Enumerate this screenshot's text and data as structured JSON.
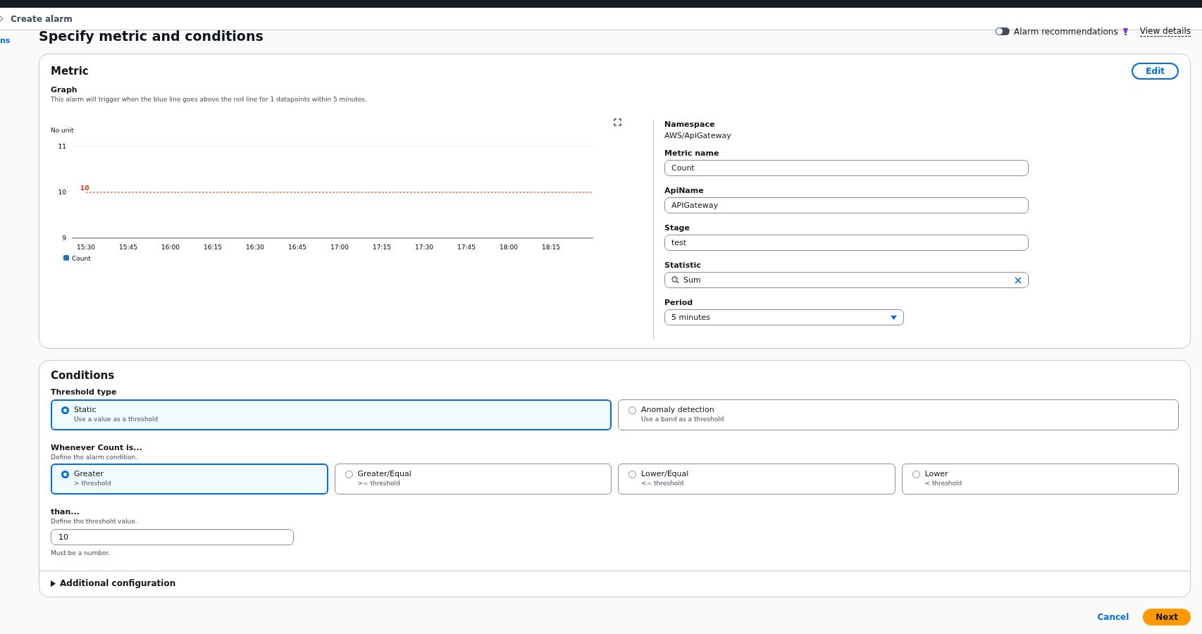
{
  "breadcrumb": {
    "current": "Create alarm"
  },
  "side_link": "ns",
  "page_title": "Specify metric and conditions",
  "recommendations": {
    "label": "Alarm recommendations",
    "on": false,
    "link": "View details"
  },
  "metric": {
    "title": "Metric",
    "edit": "Edit",
    "graph_title": "Graph",
    "graph_description": "This alarm will trigger when the blue line goes above the red line for 1 datapoints within 5 minutes.",
    "chart_data": {
      "type": "line",
      "ylabel": "No unit",
      "categories": [
        "15:30",
        "15:45",
        "16:00",
        "16:15",
        "16:30",
        "16:45",
        "17:00",
        "17:15",
        "17:30",
        "17:45",
        "18:00",
        "18:15"
      ],
      "ylim": [
        9,
        11
      ],
      "yticks": [
        9,
        10,
        11
      ],
      "series": [
        {
          "name": "Count",
          "color": "#1f77b4",
          "values": [
            null,
            null,
            null,
            null,
            null,
            null,
            null,
            null,
            null,
            null,
            null,
            null
          ]
        }
      ],
      "ref_lines": [
        {
          "axis": "y",
          "value": 10,
          "label": "10",
          "color": "#d13212"
        }
      ]
    },
    "namespace_label": "Namespace",
    "namespace": "AWS/ApiGateway",
    "fields": [
      {
        "kind": "text",
        "label": "Metric name",
        "value": "Count"
      },
      {
        "kind": "text",
        "label": "ApiName",
        "value": "APIGateway"
      },
      {
        "kind": "text",
        "label": "Stage",
        "value": "test"
      },
      {
        "kind": "search",
        "label": "Statistic",
        "value": "Sum"
      },
      {
        "kind": "select",
        "label": "Period",
        "value": "5 minutes"
      }
    ]
  },
  "conditions": {
    "title": "Conditions",
    "threshold_type_label": "Threshold type",
    "threshold_types": [
      {
        "label": "Static",
        "description": "Use a value as a threshold",
        "selected": true
      },
      {
        "label": "Anomaly detection",
        "description": "Use a band as a threshold",
        "selected": false
      }
    ],
    "whenever_label": "Whenever Count is...",
    "whenever_description": "Define the alarm condition.",
    "operators": [
      {
        "label": "Greater",
        "description": "> threshold",
        "selected": true
      },
      {
        "label": "Greater/Equal",
        "description": ">= threshold",
        "selected": false
      },
      {
        "label": "Lower/Equal",
        "description": "<= threshold",
        "selected": false
      },
      {
        "label": "Lower",
        "description": "< threshold",
        "selected": false
      }
    ],
    "than_label": "than...",
    "than_description": "Define the threshold value.",
    "threshold_value": "10",
    "threshold_hint": "Must be a number.",
    "additional": {
      "label": "Additional configuration",
      "expanded": false
    }
  },
  "footer": {
    "cancel": "Cancel",
    "next": "Next"
  }
}
